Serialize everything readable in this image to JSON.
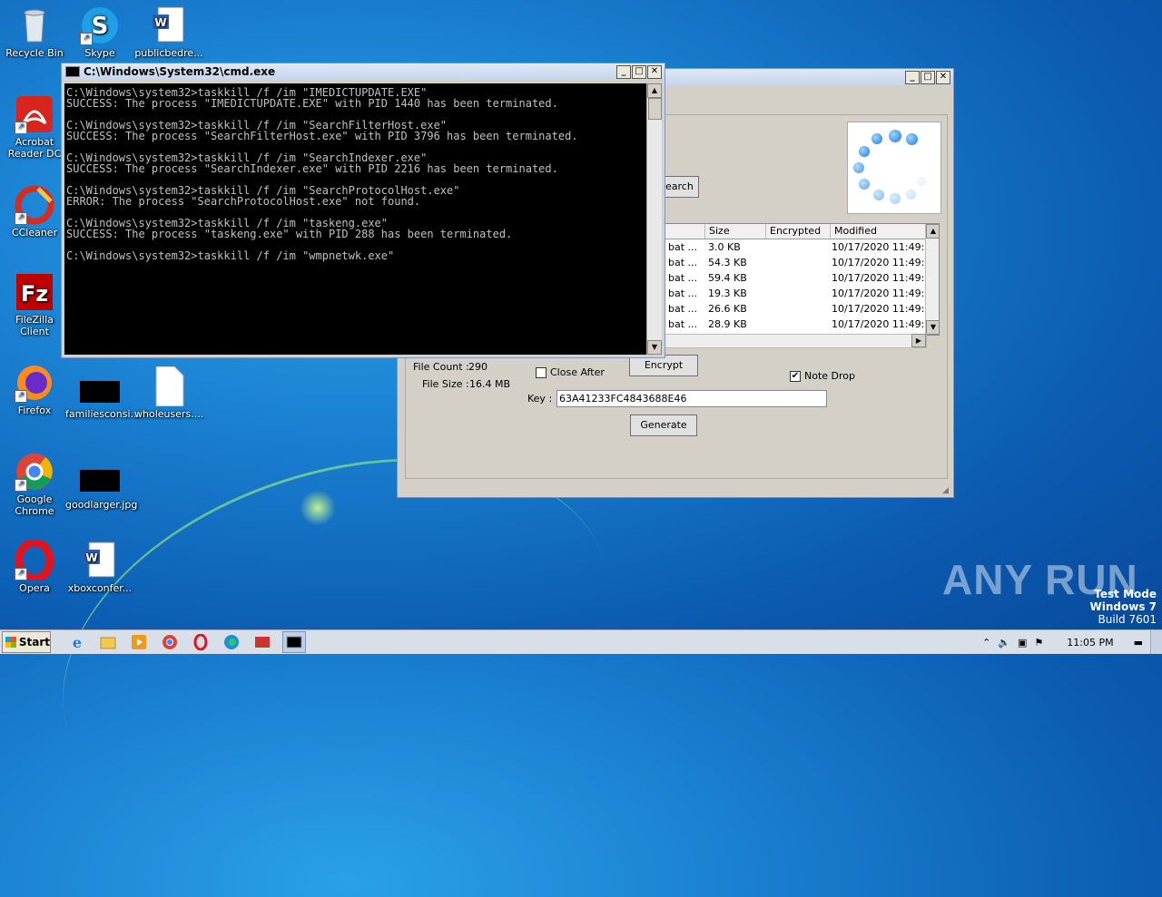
{
  "desktop": {
    "icons": [
      {
        "label": "Recycle Bin"
      },
      {
        "label": "Skype"
      },
      {
        "label": "publicbedre..."
      },
      {
        "label": "Acrobat Reader DC"
      },
      {
        "label": "CCleaner"
      },
      {
        "label": "FileZilla Client"
      },
      {
        "label": "Firefox"
      },
      {
        "label": "familiesconsi..."
      },
      {
        "label": "wholeusers...."
      },
      {
        "label": "Google Chrome"
      },
      {
        "label": "goodlarger.jpg"
      },
      {
        "label": "Opera"
      },
      {
        "label": "xboxconfer..."
      }
    ],
    "watermark": "ANY RUN",
    "test_mode": {
      "line1": "Test Mode",
      "line2": "Windows 7",
      "line3": "Build 7601"
    }
  },
  "cmd": {
    "title": "C:\\Windows\\System32\\cmd.exe",
    "lines": [
      "C:\\Windows\\system32>taskkill /f /im \"IMEDICTUPDATE.EXE\"",
      "SUCCESS: The process \"IMEDICTUPDATE.EXE\" with PID 1440 has been terminated.",
      "",
      "C:\\Windows\\system32>taskkill /f /im \"SearchFilterHost.exe\"",
      "SUCCESS: The process \"SearchFilterHost.exe\" with PID 3796 has been terminated.",
      "",
      "C:\\Windows\\system32>taskkill /f /im \"SearchIndexer.exe\"",
      "SUCCESS: The process \"SearchIndexer.exe\" with PID 2216 has been terminated.",
      "",
      "C:\\Windows\\system32>taskkill /f /im \"SearchProtocolHost.exe\"",
      "ERROR: The process \"SearchProtocolHost.exe\" not found.",
      "",
      "C:\\Windows\\system32>taskkill /f /im \"taskeng.exe\"",
      "SUCCESS: The process \"taskeng.exe\" with PID 288 has been terminated.",
      "",
      "C:\\Windows\\system32>taskkill /f /im \"wmpnetwk.exe\""
    ]
  },
  "app": {
    "search_button": "earch",
    "columns": [
      "Size",
      "Encrypted",
      "Modified"
    ],
    "rows": [
      {
        "type": "bat ...",
        "size": "3.0 KB",
        "encrypted": "",
        "modified": "10/17/2020 11:49:..."
      },
      {
        "type": "bat ...",
        "size": "54.3 KB",
        "encrypted": "",
        "modified": "10/17/2020 11:49:..."
      },
      {
        "type": "bat ...",
        "size": "59.4 KB",
        "encrypted": "",
        "modified": "10/17/2020 11:49:..."
      },
      {
        "type": "bat ...",
        "size": "19.3 KB",
        "encrypted": "",
        "modified": "10/17/2020 11:49:..."
      },
      {
        "type": "bat ...",
        "size": "26.6 KB",
        "encrypted": "",
        "modified": "10/17/2020 11:49:..."
      },
      {
        "type": "bat ...",
        "size": "28.9 KB",
        "encrypted": "",
        "modified": "10/17/2020 11:49:..."
      }
    ],
    "file_count_label": "File Count :",
    "file_count": "290",
    "file_size_label": "File Size :",
    "file_size": "16.4 MB",
    "close_after": "Close After",
    "encrypt_button": "Encrypt",
    "note_drop": "Note Drop",
    "note_drop_checked": "✔",
    "key_label": "Key :",
    "key_value": "63A41233FC4843688E46",
    "generate_button": "Generate"
  },
  "taskbar": {
    "start": "Start",
    "clock": "11:05 PM"
  }
}
